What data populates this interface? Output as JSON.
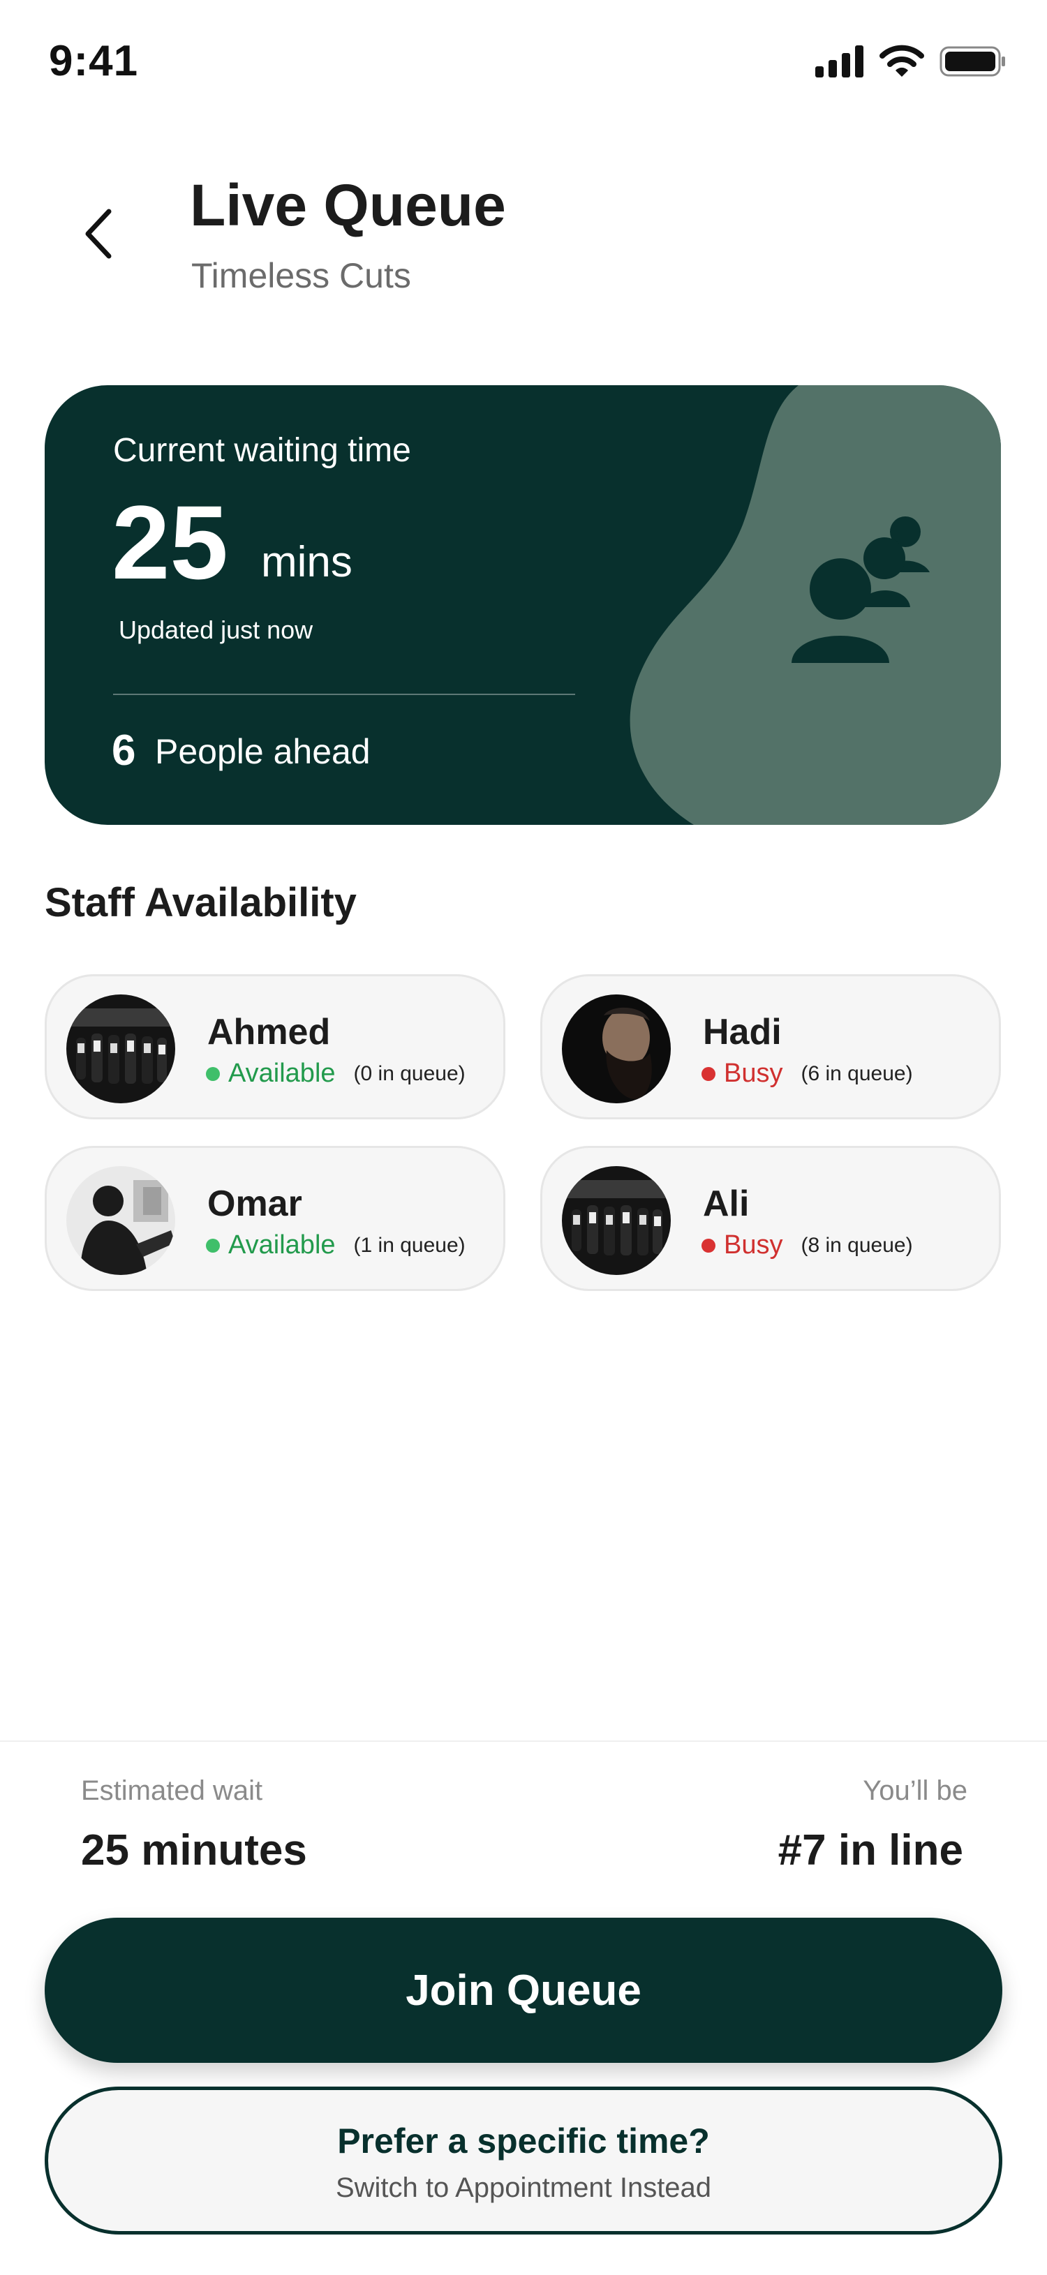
{
  "status_bar": {
    "time": "9:41",
    "icons": [
      "cellular-signal-icon",
      "wifi-icon",
      "battery-icon"
    ]
  },
  "header": {
    "back_icon": "chevron-left-icon",
    "title": "Live Queue",
    "subtitle": "Timeless Cuts"
  },
  "wait_card": {
    "label": "Current waiting time",
    "value": "25",
    "unit": "mins",
    "updated": "Updated just now",
    "people_ahead_count": "6",
    "people_ahead_label": "People ahead",
    "icon": "people-group-icon"
  },
  "staff": {
    "title": "Staff Availability",
    "members": [
      {
        "name": "Ahmed",
        "status": "Available",
        "queue": "(0 in queue)"
      },
      {
        "name": "Hadi",
        "status": "Busy",
        "queue": "(6 in queue)"
      },
      {
        "name": "Omar",
        "status": "Available",
        "queue": "(1 in queue)"
      },
      {
        "name": "Ali",
        "status": "Busy",
        "queue": "(8 in queue)"
      }
    ]
  },
  "summary": {
    "estimated_label": "Estimated wait",
    "estimated_value": "25 minutes",
    "position_label": "You’ll be",
    "position_value": "#7 in line"
  },
  "actions": {
    "join_label": "Join Queue",
    "appointment_title": "Prefer a specific time?",
    "appointment_subtitle": "Switch to Appointment Instead"
  },
  "colors": {
    "primary": "#08302d",
    "card_accent": "#537268",
    "available": "#229a4c",
    "busy": "#d0302f"
  }
}
